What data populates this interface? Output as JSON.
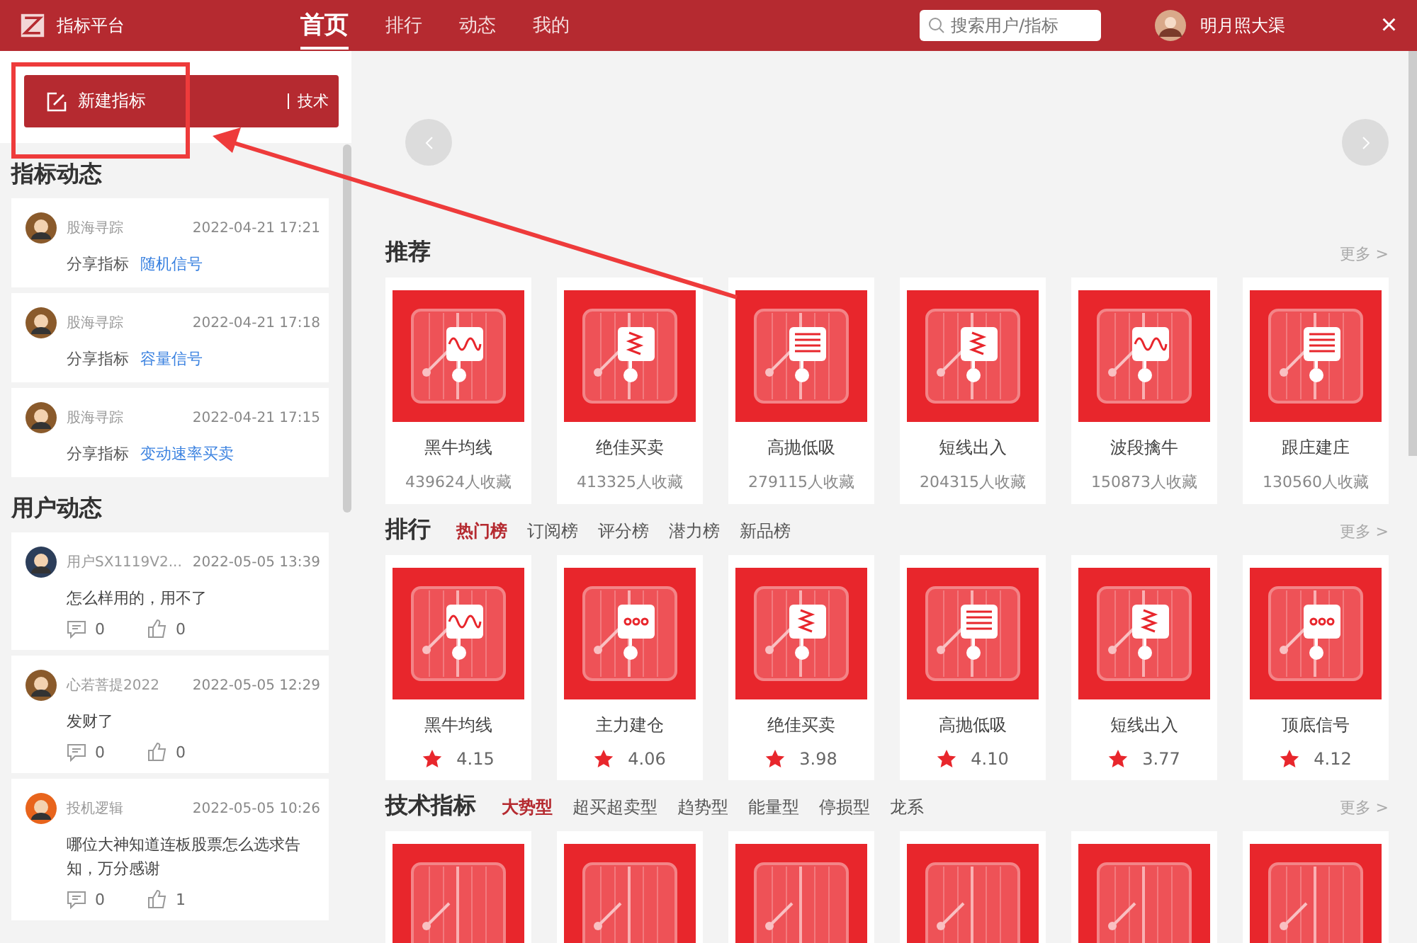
{
  "header": {
    "app_name": "指标平台",
    "nav": [
      {
        "label": "首页",
        "selected": true
      },
      {
        "label": "排行",
        "selected": false
      },
      {
        "label": "动态",
        "selected": false
      },
      {
        "label": "我的",
        "selected": false
      }
    ],
    "search": {
      "placeholder": "搜索用户/指标"
    },
    "user_name": "明月照大渠",
    "close": "×"
  },
  "sidebar": {
    "new_button": "新建指标",
    "side_tab": "技术",
    "indicator_feed": {
      "title": "指标动态",
      "items": [
        {
          "user": "股海寻踪",
          "time": "2022-04-21 17:21",
          "action": "分享指标",
          "link": "随机信号"
        },
        {
          "user": "股海寻踪",
          "time": "2022-04-21 17:18",
          "action": "分享指标",
          "link": "容量信号"
        },
        {
          "user": "股海寻踪",
          "time": "2022-04-21 17:15",
          "action": "分享指标",
          "link": "变动速率买卖"
        }
      ]
    },
    "user_feed": {
      "title": "用户动态",
      "items": [
        {
          "user": "用户SX1119V2...",
          "time": "2022-05-05 13:39",
          "text": "怎么样用的，用不了",
          "comments": "0",
          "likes": "0",
          "color": "#2c3e5a"
        },
        {
          "user": "心若菩提2022",
          "time": "2022-05-05 12:29",
          "text": "发财了",
          "comments": "0",
          "likes": "0",
          "color": "#8a5a2b"
        },
        {
          "user": "投机逻辑",
          "time": "2022-05-05 10:26",
          "text": "哪位大神知道连板股票怎么选求告知，万分感谢",
          "comments": "0",
          "likes": "1",
          "color": "#e8641c"
        }
      ]
    }
  },
  "recommend": {
    "title": "推荐",
    "more": "更多 >",
    "cards": [
      {
        "name": "黑牛均线",
        "count": "439624人收藏",
        "kind": "wave"
      },
      {
        "name": "绝佳买卖",
        "count": "413325人收藏",
        "kind": "spring"
      },
      {
        "name": "高抛低吸",
        "count": "279115人收藏",
        "kind": "lines"
      },
      {
        "name": "短线出入",
        "count": "204315人收藏",
        "kind": "spring"
      },
      {
        "name": "波段擒牛",
        "count": "150873人收藏",
        "kind": "wave"
      },
      {
        "name": "跟庄建庄",
        "count": "130560人收藏",
        "kind": "lines"
      }
    ]
  },
  "ranking": {
    "title": "排行",
    "more": "更多 >",
    "tabs": [
      {
        "label": "热门榜",
        "selected": true
      },
      {
        "label": "订阅榜",
        "selected": false
      },
      {
        "label": "评分榜",
        "selected": false
      },
      {
        "label": "潜力榜",
        "selected": false
      },
      {
        "label": "新品榜",
        "selected": false
      }
    ],
    "cards": [
      {
        "name": "黑牛均线",
        "rating": "4.15",
        "kind": "wave"
      },
      {
        "name": "主力建仓",
        "rating": "4.06",
        "kind": "dots"
      },
      {
        "name": "绝佳买卖",
        "rating": "3.98",
        "kind": "spring"
      },
      {
        "name": "高抛低吸",
        "rating": "4.10",
        "kind": "lines"
      },
      {
        "name": "短线出入",
        "rating": "3.77",
        "kind": "spring"
      },
      {
        "name": "顶底信号",
        "rating": "4.12",
        "kind": "dots"
      }
    ]
  },
  "technical": {
    "title": "技术指标",
    "more": "更多 >",
    "tabs": [
      {
        "label": "大势型",
        "selected": true
      },
      {
        "label": "超买超卖型",
        "selected": false
      },
      {
        "label": "趋势型",
        "selected": false
      },
      {
        "label": "能量型",
        "selected": false
      },
      {
        "label": "停损型",
        "selected": false
      },
      {
        "label": "龙系",
        "selected": false
      }
    ],
    "cards": [
      {
        "kind": "blank"
      },
      {
        "kind": "blank"
      },
      {
        "kind": "blank"
      },
      {
        "kind": "blank"
      },
      {
        "kind": "blank"
      },
      {
        "kind": "blank"
      }
    ]
  }
}
